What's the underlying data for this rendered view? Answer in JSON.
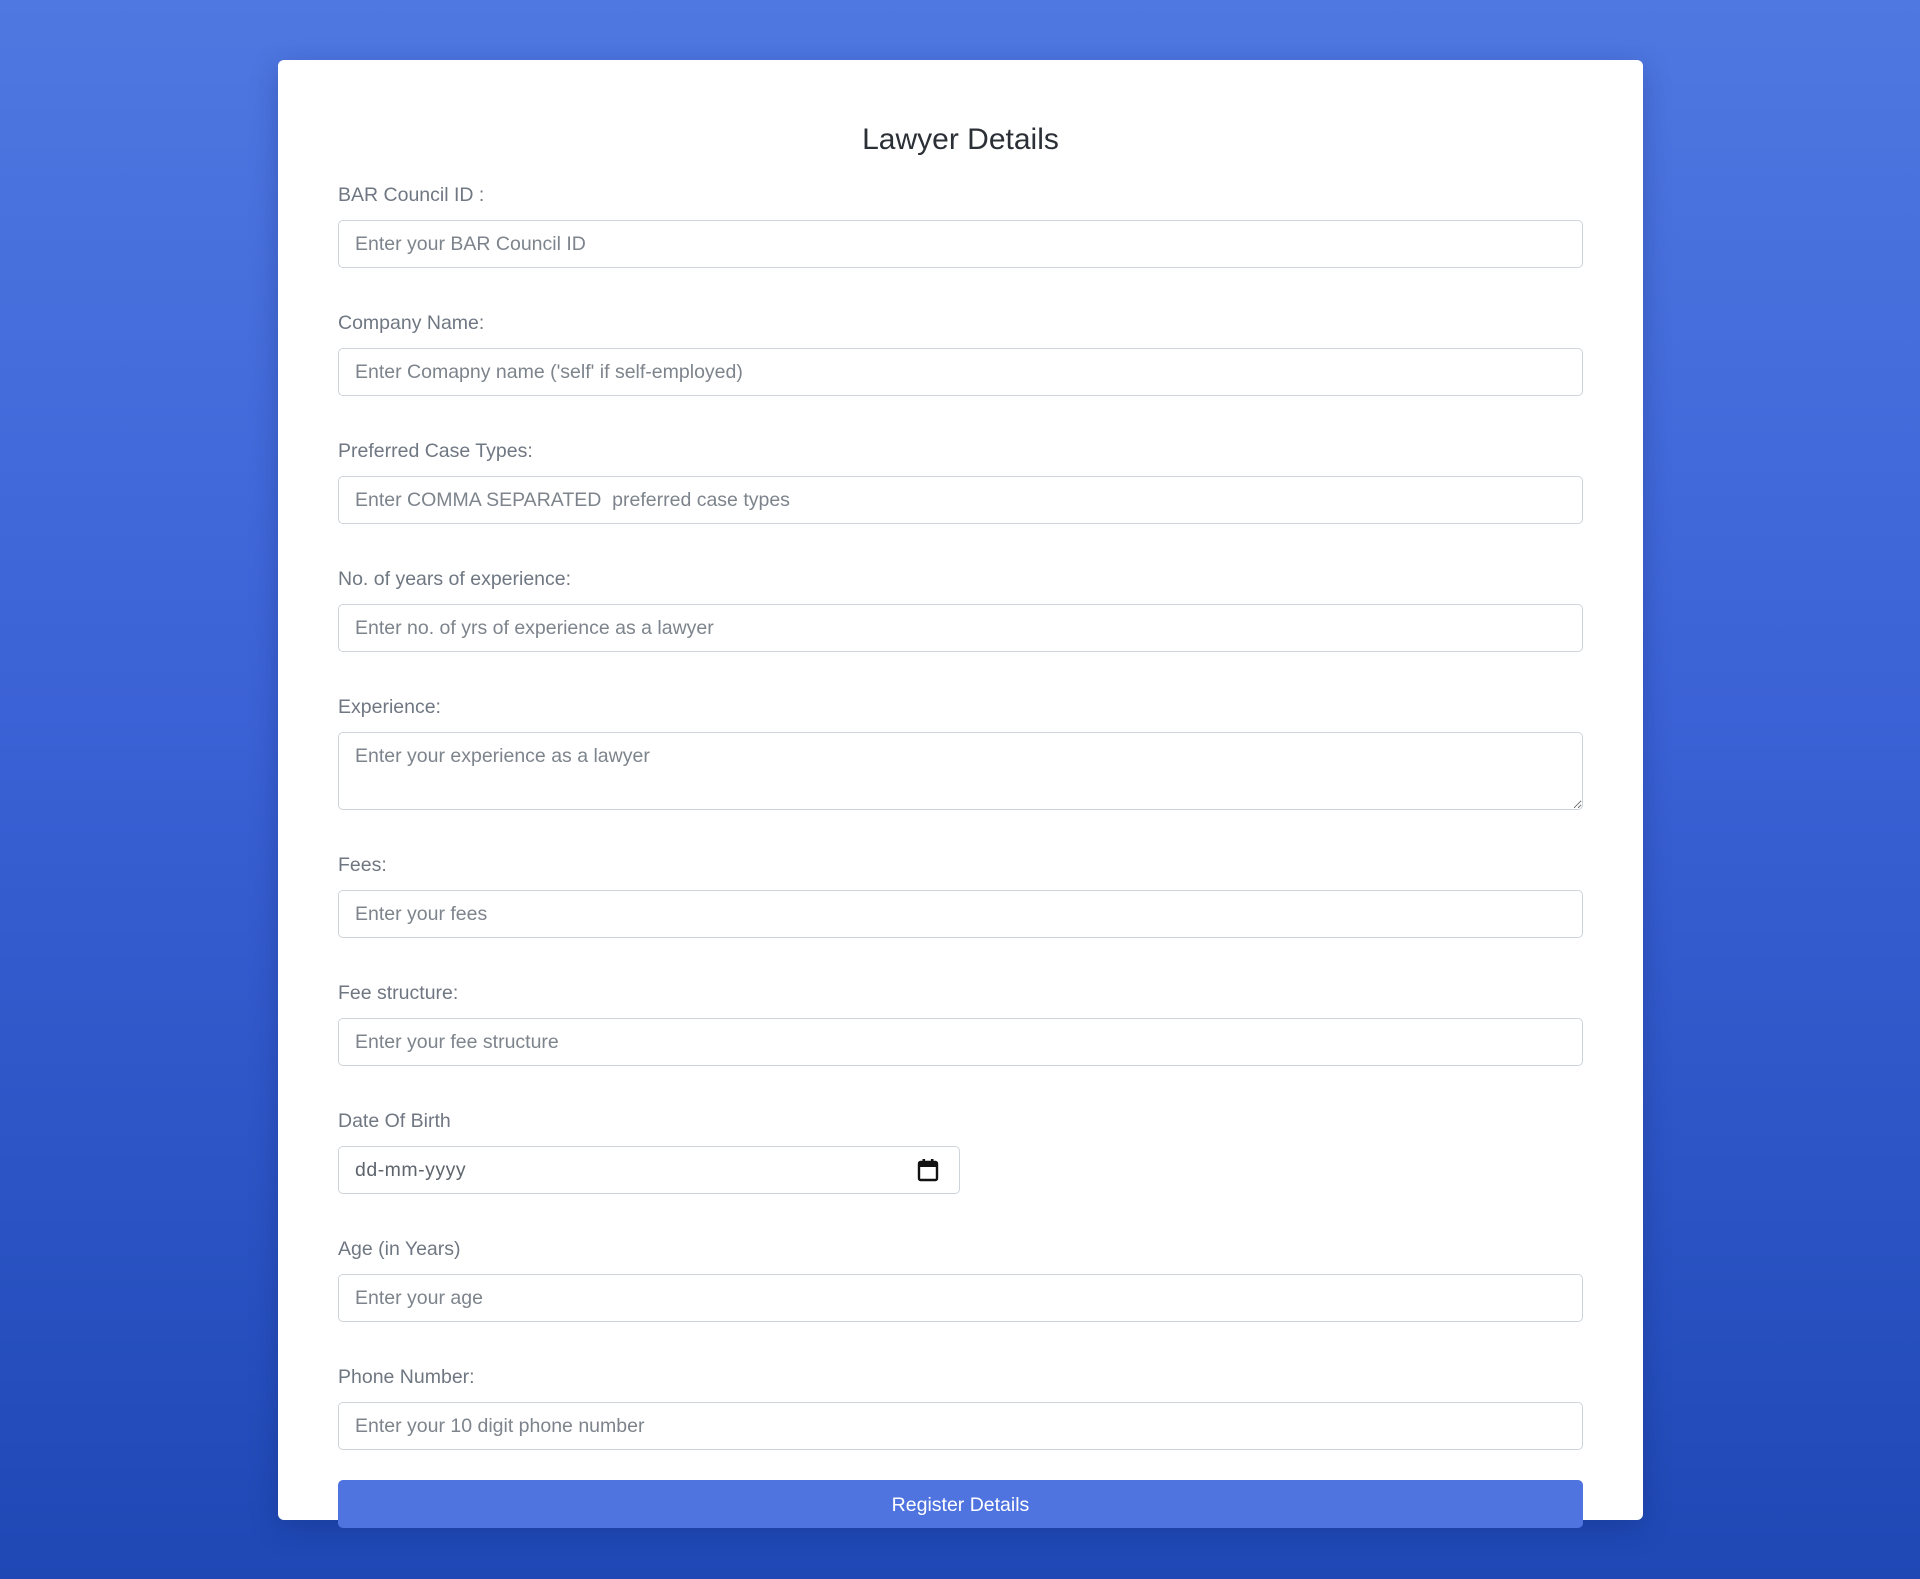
{
  "form": {
    "title": "Lawyer Details",
    "fields": {
      "bar_council_id": {
        "label": "BAR Council ID :",
        "placeholder": "Enter your BAR Council ID"
      },
      "company_name": {
        "label": "Company Name:",
        "placeholder": "Enter Comapny name ('self' if self-employed)"
      },
      "preferred_case_types": {
        "label": "Preferred Case Types:",
        "placeholder": "Enter COMMA SEPARATED  preferred case types"
      },
      "years_experience": {
        "label": "No. of years of experience:",
        "placeholder": "Enter no. of yrs of experience as a lawyer"
      },
      "experience": {
        "label": "Experience:",
        "placeholder": "Enter your experience as a lawyer"
      },
      "fees": {
        "label": "Fees:",
        "placeholder": "Enter your fees"
      },
      "fee_structure": {
        "label": "Fee structure:",
        "placeholder": "Enter your fee structure"
      },
      "date_of_birth": {
        "label": "Date Of Birth",
        "placeholder": "dd-mm-yyyy",
        "icon": "calendar-icon"
      },
      "age": {
        "label": "Age (in Years)",
        "placeholder": "Enter your age"
      },
      "phone_number": {
        "label": "Phone Number:",
        "placeholder": "Enter your 10 digit phone number"
      }
    },
    "submit_label": "Register Details"
  },
  "colors": {
    "background_top": "#4f78e1",
    "background_bottom": "#1f48b5",
    "button": "#4f74e0",
    "card": "#ffffff"
  }
}
